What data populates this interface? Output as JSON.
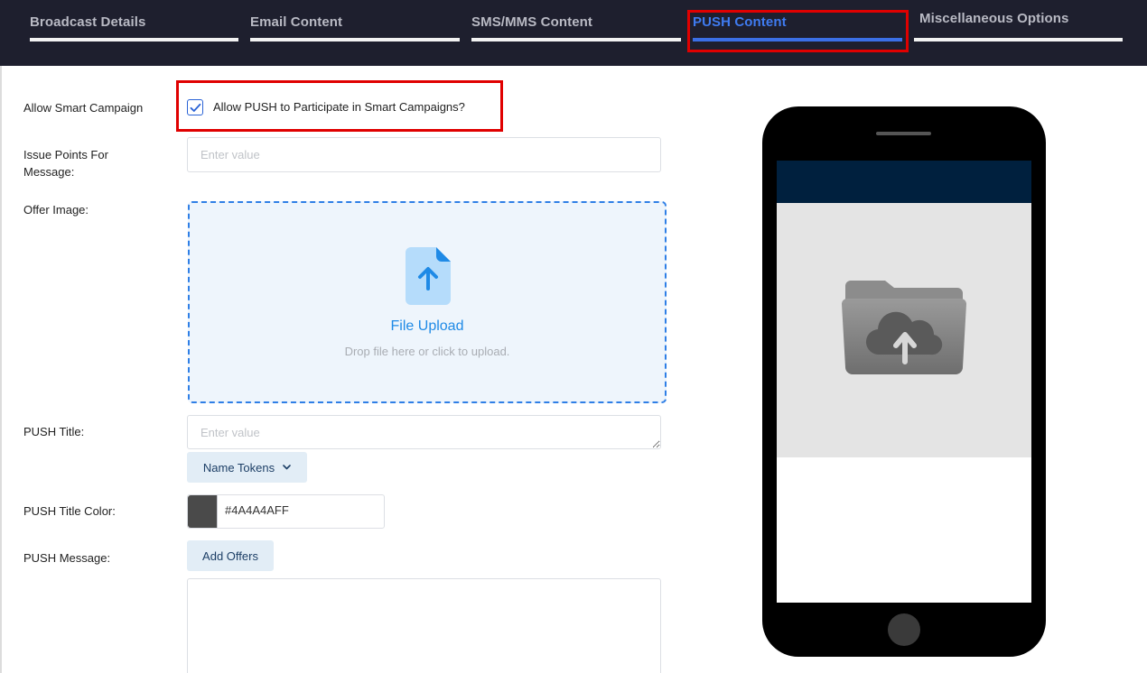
{
  "tabs": [
    {
      "label": "Broadcast Details",
      "active": false
    },
    {
      "label": "Email Content",
      "active": false
    },
    {
      "label": "SMS/MMS Content",
      "active": false
    },
    {
      "label": "PUSH Content",
      "active": true
    },
    {
      "label": "Miscellaneous Options",
      "active": false
    }
  ],
  "form": {
    "smart_campaign": {
      "label": "Allow Smart Campaign",
      "checkbox_label": "Allow PUSH to Participate in Smart Campaigns?",
      "checked": true
    },
    "issue_points": {
      "label_line1": "Issue Points For",
      "label_line2": "Message:",
      "placeholder": "Enter value"
    },
    "offer_image": {
      "label": "Offer Image:",
      "upload_title": "File Upload",
      "upload_hint": "Drop file here or click to upload."
    },
    "push_title": {
      "label": "PUSH Title:",
      "placeholder": "Enter value",
      "tokens_button": "Name Tokens"
    },
    "push_title_color": {
      "label": "PUSH Title Color:",
      "value": "#4A4A4AFF",
      "swatch_color": "#4a4a4a"
    },
    "push_message": {
      "label": "PUSH Message:",
      "add_offers_button": "Add Offers",
      "value": ""
    }
  },
  "colors": {
    "tabbar_bg": "#1e1f2e",
    "active_tab": "#3f7bf0",
    "highlight_border": "#e00000",
    "upload_accent": "#1f8ae6",
    "phone_header": "#00203e"
  }
}
